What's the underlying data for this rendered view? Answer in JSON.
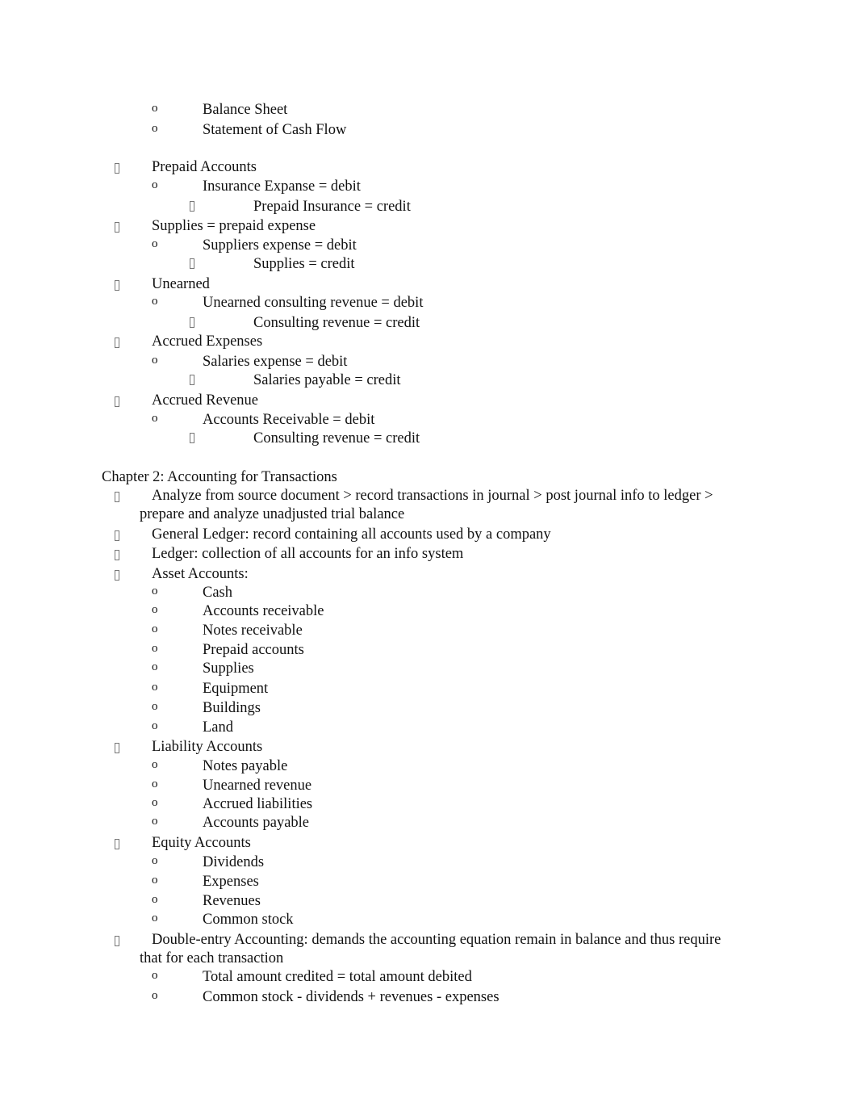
{
  "top_items": [
    {
      "level": 2,
      "text": "Balance Sheet"
    },
    {
      "level": 2,
      "text": "Statement of Cash Flow"
    }
  ],
  "adjustments": [
    {
      "level": 1,
      "text": "Prepaid Accounts"
    },
    {
      "level": 2,
      "text": "Insurance Expanse = debit"
    },
    {
      "level": 3,
      "text": "Prepaid Insurance = credit"
    },
    {
      "level": 1,
      "text": "Supplies = prepaid expense"
    },
    {
      "level": 2,
      "text": "Suppliers expense = debit"
    },
    {
      "level": 3,
      "text": "Supplies = credit"
    },
    {
      "level": 1,
      "text": "Unearned"
    },
    {
      "level": 2,
      "text": "Unearned consulting revenue = debit"
    },
    {
      "level": 3,
      "text": "Consulting revenue = credit"
    },
    {
      "level": 1,
      "text": "Accrued Expenses"
    },
    {
      "level": 2,
      "text": "Salaries expense = debit"
    },
    {
      "level": 3,
      "text": "Salaries payable = credit"
    },
    {
      "level": 1,
      "text": "Accrued Revenue"
    },
    {
      "level": 2,
      "text": "Accounts Receivable = debit"
    },
    {
      "level": 3,
      "text": "Consulting revenue = credit"
    }
  ],
  "chapter2": {
    "heading": "Chapter 2: Accounting for Transactions",
    "process": {
      "line1": "Analyze from source document > record transactions in journal > post journal info to ledger >",
      "line2": "prepare and analyze unadjusted trial balance"
    },
    "general_ledger": "General Ledger: record containing all accounts used by a company",
    "ledger": "Ledger: collection of all accounts for an info system",
    "asset_heading": "Asset Accounts:",
    "assets": [
      "Cash",
      "Accounts receivable",
      "Notes receivable",
      "Prepaid accounts",
      "Supplies",
      "Equipment",
      "Buildings",
      "Land"
    ],
    "liability_heading": "Liability Accounts",
    "liabilities": [
      "Notes payable",
      "Unearned revenue",
      "Accrued liabilities",
      "Accounts payable"
    ],
    "equity_heading": "Equity Accounts",
    "equity": [
      "Dividends",
      "Expenses",
      "Revenues",
      "Common stock"
    ],
    "double_entry": {
      "line1": "Double-entry Accounting:  demands the accounting equation remain in balance and thus require",
      "line2": "that for each transaction"
    },
    "double_entry_items": [
      "Total amount credited = total amount debited",
      "Common stock - dividends + revenues - expenses"
    ]
  },
  "bullets": {
    "level1": "missing-glyph-box",
    "level2": "o",
    "level3": "missing-glyph-box"
  }
}
